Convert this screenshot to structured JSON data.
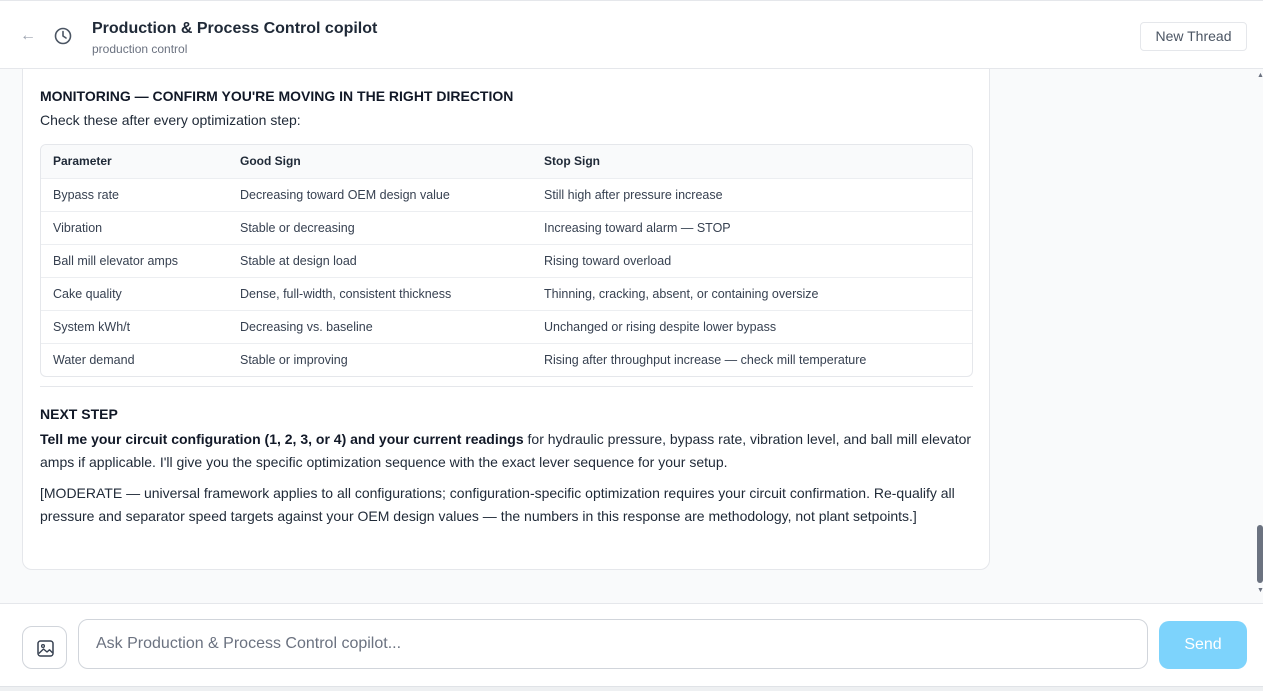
{
  "header": {
    "back_icon": "arrow-left-icon",
    "history_icon": "clock-icon",
    "title": "Production & Process Control copilot",
    "subtitle": "production control",
    "new_thread_label": "New Thread"
  },
  "message": {
    "monitoring_heading": "MONITORING — CONFIRM YOU'RE MOVING IN THE RIGHT DIRECTION",
    "monitoring_intro": "Check these after every optimization step:",
    "table": {
      "headers": [
        "Parameter",
        "Good Sign",
        "Stop Sign"
      ],
      "rows": [
        [
          "Bypass rate",
          "Decreasing toward OEM design value",
          "Still high after pressure increase"
        ],
        [
          "Vibration",
          "Stable or decreasing",
          "Increasing toward alarm — STOP"
        ],
        [
          "Ball mill elevator amps",
          "Stable at design load",
          "Rising toward overload"
        ],
        [
          "Cake quality",
          "Dense, full-width, consistent thickness",
          "Thinning, cracking, absent, or containing oversize"
        ],
        [
          "System kWh/t",
          "Decreasing vs. baseline",
          "Unchanged or rising despite lower bypass"
        ],
        [
          "Water demand",
          "Stable or improving",
          "Rising after throughput increase — check mill temperature"
        ]
      ]
    },
    "next_step_heading": "NEXT STEP",
    "next_step_bold": "Tell me your circuit configuration (1, 2, 3, or 4) and your current readings",
    "next_step_text": " for hydraulic pressure, bypass rate, vibration level, and ball mill elevator amps if applicable. I'll give you the specific optimization sequence with the exact lever sequence for your setup.",
    "confidence_note": "[MODERATE — universal framework applies to all configurations; configuration-specific optimization requires your circuit confirmation. Re-qualify all pressure and separator speed targets against your OEM design values — the numbers in this response are methodology, not plant setpoints.]"
  },
  "composer": {
    "image_icon": "image-upload-icon",
    "placeholder": "Ask Production & Process Control copilot...",
    "value": "",
    "send_label": "Send"
  },
  "colors": {
    "accent_send": "#7dd3fc",
    "border": "#e5e7eb",
    "content_bg": "#f9fafb"
  }
}
